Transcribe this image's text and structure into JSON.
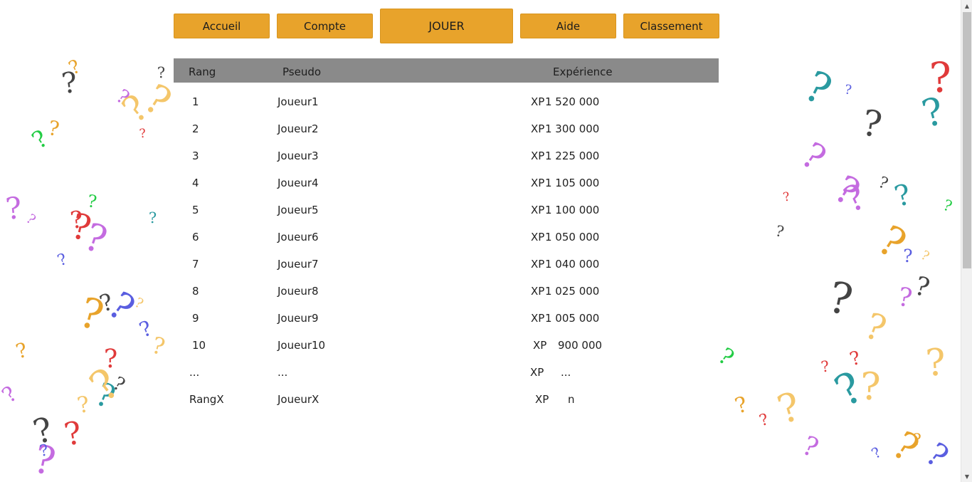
{
  "nav": {
    "accueil": "Accueil",
    "compte": "Compte",
    "jouer": "JOUER",
    "aide": "Aide",
    "classement": "Classement"
  },
  "table": {
    "headers": {
      "rank": "Rang",
      "name": "Pseudo",
      "xp": "Expérience"
    },
    "rows": [
      {
        "rank": "1",
        "name": "Joueur1",
        "xp_label": "XP",
        "xp_value": "1 520 000"
      },
      {
        "rank": "2",
        "name": "Joueur2",
        "xp_label": "XP",
        "xp_value": "1 300 000"
      },
      {
        "rank": "3",
        "name": "Joueur3",
        "xp_label": "XP",
        "xp_value": "1 225 000"
      },
      {
        "rank": "4",
        "name": "Joueur4",
        "xp_label": "XP",
        "xp_value": "1 105 000"
      },
      {
        "rank": "5",
        "name": "Joueur5",
        "xp_label": "XP",
        "xp_value": "1 100 000"
      },
      {
        "rank": "6",
        "name": "Joueur6",
        "xp_label": "XP",
        "xp_value": "1 050 000"
      },
      {
        "rank": "7",
        "name": "Joueur7",
        "xp_label": "XP",
        "xp_value": "1 040 000"
      },
      {
        "rank": "8",
        "name": "Joueur8",
        "xp_label": "XP",
        "xp_value": "1 025 000"
      },
      {
        "rank": "9",
        "name": "Joueur9",
        "xp_label": "XP",
        "xp_value": "1 005 000"
      },
      {
        "rank": "10",
        "name": "Joueur10",
        "xp_label": "XP",
        "xp_value": "900 000"
      },
      {
        "rank": "...",
        "name": "...",
        "xp_label": "XP",
        "xp_value": "..."
      },
      {
        "rank": "RangX",
        "name": "JoueurX",
        "xp_label": "XP",
        "xp_value": "n"
      }
    ]
  },
  "colors": {
    "button": "#e8a32b",
    "header": "#8a8a8a",
    "qm_palette": [
      "#c46be0",
      "#2a9aa0",
      "#e8a32b",
      "#f4c66a",
      "#5a5ee0",
      "#22cc44",
      "#e03a3a",
      "#444444"
    ]
  },
  "background": {
    "icon": "question-mark-icon"
  }
}
